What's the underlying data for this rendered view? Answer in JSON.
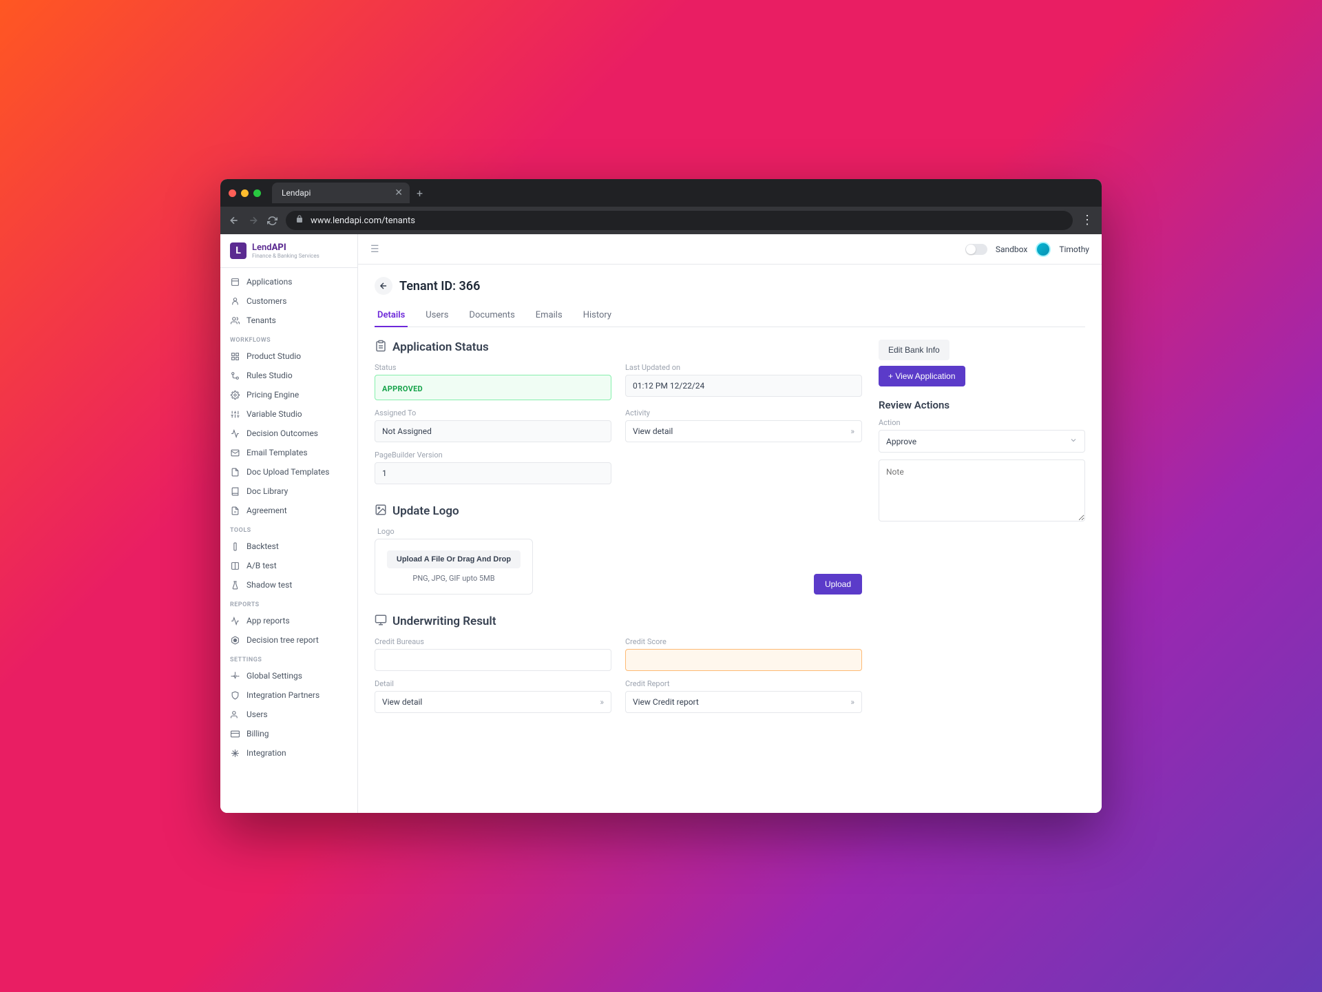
{
  "browser": {
    "tab_title": "Lendapi",
    "url": "www.lendapi.com/tenants"
  },
  "logo": {
    "badge": "L",
    "title_lend": "Lend",
    "title_api": "API",
    "subtitle": "Finance & Banking Services"
  },
  "sidebar": {
    "main_items": [
      {
        "label": "Applications"
      },
      {
        "label": "Customers"
      },
      {
        "label": "Tenants"
      }
    ],
    "workflows_title": "WORKFLOWS",
    "workflows_items": [
      {
        "label": "Product Studio"
      },
      {
        "label": "Rules Studio"
      },
      {
        "label": "Pricing Engine"
      },
      {
        "label": "Variable Studio"
      },
      {
        "label": "Decision Outcomes"
      },
      {
        "label": "Email Templates"
      },
      {
        "label": "Doc Upload Templates"
      },
      {
        "label": "Doc Library"
      },
      {
        "label": "Agreement"
      }
    ],
    "tools_title": "TOOLS",
    "tools_items": [
      {
        "label": "Backtest"
      },
      {
        "label": "A/B test"
      },
      {
        "label": "Shadow test"
      }
    ],
    "reports_title": "REPORTS",
    "reports_items": [
      {
        "label": "App reports"
      },
      {
        "label": "Decision tree report"
      }
    ],
    "settings_title": "SETTINGS",
    "settings_items": [
      {
        "label": "Global Settings"
      },
      {
        "label": "Integration Partners"
      },
      {
        "label": "Users"
      },
      {
        "label": "Billing"
      },
      {
        "label": "Integration"
      }
    ]
  },
  "topbar": {
    "sandbox_label": "Sandbox",
    "user_name": "Timothy"
  },
  "page": {
    "title": "Tenant ID: 366",
    "tabs": [
      {
        "label": "Details"
      },
      {
        "label": "Users"
      },
      {
        "label": "Documents"
      },
      {
        "label": "Emails"
      },
      {
        "label": "History"
      }
    ]
  },
  "status_section": {
    "title": "Application Status",
    "status_label": "Status",
    "status_value": "APPROVED",
    "last_updated_label": "Last Updated on",
    "last_updated_value": "01:12 PM 12/22/24",
    "assigned_to_label": "Assigned To",
    "assigned_to_value": "Not Assigned",
    "activity_label": "Activity",
    "activity_value": "View detail",
    "pagebuilder_label": "PageBuilder Version",
    "pagebuilder_value": "1"
  },
  "logo_section": {
    "title": "Update Logo",
    "logo_label": "Logo",
    "upload_btn": "Upload A File Or Drag And Drop",
    "upload_hint": "PNG, JPG, GIF upto 5MB",
    "upload_action": "Upload"
  },
  "underwriting_section": {
    "title": "Underwriting Result",
    "credit_bureaus_label": "Credit Bureaus",
    "credit_score_label": "Credit Score",
    "detail_label": "Detail",
    "detail_value": "View detail",
    "credit_report_label": "Credit Report",
    "credit_report_value": "View Credit report"
  },
  "actions": {
    "edit_bank": "Edit Bank Info",
    "view_app": "+ View Application",
    "review_title": "Review Actions",
    "action_label": "Action",
    "action_value": "Approve",
    "note_placeholder": "Note"
  }
}
